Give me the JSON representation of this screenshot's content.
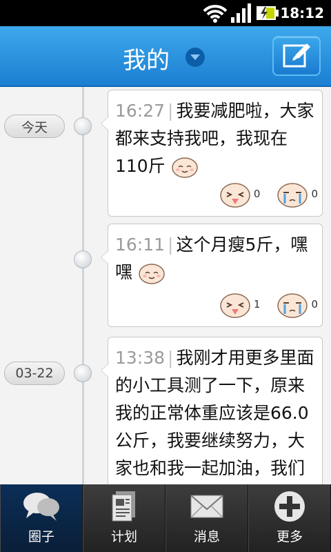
{
  "status_bar": {
    "time": "18:12"
  },
  "header": {
    "title": "我的"
  },
  "timeline": {
    "dates": [
      "今天",
      "03-22"
    ],
    "posts": [
      {
        "time": "16:27",
        "text": "我要减肥啦，大家都来支持我吧，我现在110斤",
        "like_count": "0",
        "cry_count": "0"
      },
      {
        "time": "16:11",
        "text": "这个月瘦5斤，嘿嘿",
        "like_count": "1",
        "cry_count": "0"
      },
      {
        "time": "13:38",
        "text": "我刚才用更多里面的小工具测了一下，原来我的正常体重应该是66.0公斤，我要继续努力，大家也和我一起加油，我们争取更快达到理想目标，开始“享瘦生"
      }
    ]
  },
  "bottom_nav": [
    {
      "label": "圈子",
      "icon": "chat-bubbles-icon",
      "active": true
    },
    {
      "label": "计划",
      "icon": "document-icon"
    },
    {
      "label": "消息",
      "icon": "envelope-icon"
    },
    {
      "label": "更多",
      "icon": "plus-circle-icon"
    }
  ],
  "colors": {
    "header_blue": "#1b7fd2",
    "nav_active": "#0b2e57"
  }
}
